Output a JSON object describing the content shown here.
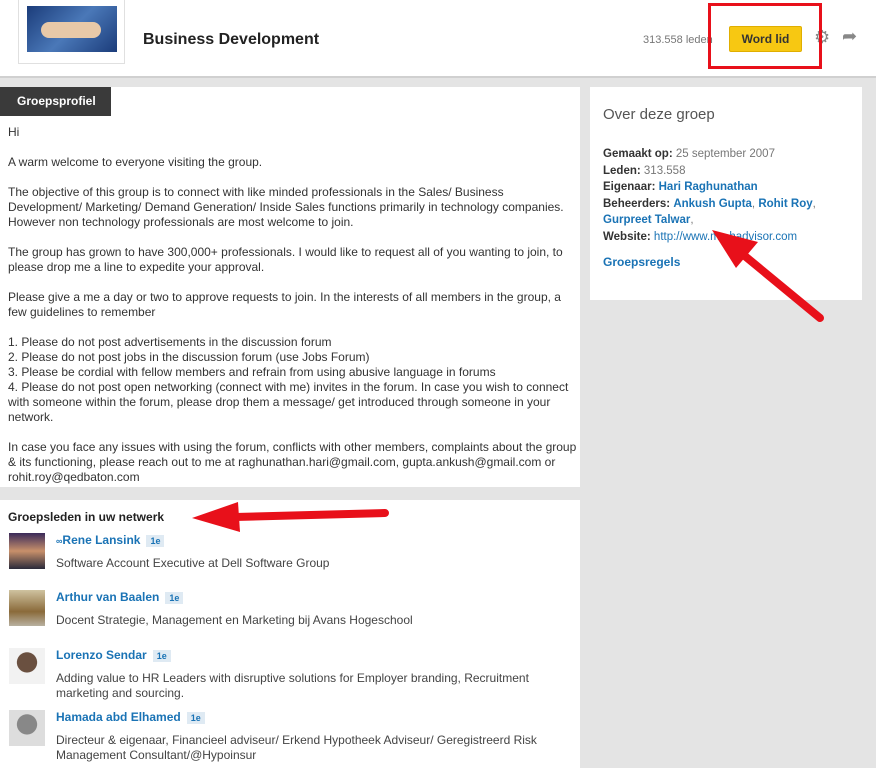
{
  "header": {
    "title": "Business Development",
    "members": "313.558 leden",
    "join_label": "Word lid"
  },
  "tab": "Groepsprofiel",
  "description": [
    "Hi",
    "A warm welcome to everyone visiting the group.",
    "The objective of this group is to connect with like minded professionals in the Sales/ Business Development/ Marketing/ Demand Generation/ Inside Sales functions primarily in technology companies. However non technology professionals are most welcome to join.",
    "The group has grown to have 300,000+ professionals. I would like to request all of you wanting to join, to please drop me a line to expedite your approval.",
    "Please give a me a day or two to approve requests to join. In the interests of all members in the group, a few guidelines to remember",
    "1. Please do not post advertisements in the discussion forum\n2. Please do not post jobs in the discussion forum (use Jobs Forum)\n3. Please be cordial with fellow members and refrain from using abusive language in forums\n4. Please do not post open networking (connect with me) invites in the forum. In case you wish to connect with someone within the forum, please drop them a message/ get introduced through someone in your network.",
    "In case you face any issues with using the forum, conflicts with other members, complaints about the group & its functioning, please reach out to me at raghunathan.hari@gmail.com, gupta.ankush@gmail.com or rohit.roy@qedbaton.com"
  ],
  "about": {
    "title": "Over deze groep",
    "created_label": "Gemaakt op:",
    "created": "25 september 2007",
    "members_label": "Leden:",
    "members": "313.558",
    "owner_label": "Eigenaar:",
    "owner": "Hari Raghunathan",
    "managers_label": "Beheerders:",
    "managers": [
      "Ankush Gupta",
      "Rohit Roy",
      "Gurpreet Talwar"
    ],
    "website_label": "Website:",
    "website": "http://www.m...hadvisor.com",
    "rules": "Groepsregels"
  },
  "network": {
    "title": "Groepsleden in uw netwerk",
    "people": [
      {
        "name": "Rene Lansink",
        "prefix": "∞",
        "degree": "1e",
        "title": "Software Account Executive at Dell Software Group"
      },
      {
        "name": "Arthur van Baalen",
        "prefix": "",
        "degree": "1e",
        "title": "Docent Strategie, Management en Marketing bij Avans Hogeschool"
      },
      {
        "name": "Lorenzo Sendar",
        "prefix": "",
        "degree": "1e",
        "title": "Adding value to HR Leaders with disruptive solutions for Employer branding, Recruitment marketing and sourcing."
      },
      {
        "name": "Hamada abd Elhamed",
        "prefix": "",
        "degree": "1e",
        "title": "Directeur & eigenaar, Financieel adviseur/ Erkend Hypotheek Adviseur/ Geregistreerd Risk Management Consultant/@Hypoinsur"
      }
    ]
  },
  "colors": {
    "accent": "#f7c812",
    "link": "#1a73b5",
    "annotation": "#e8101a"
  }
}
